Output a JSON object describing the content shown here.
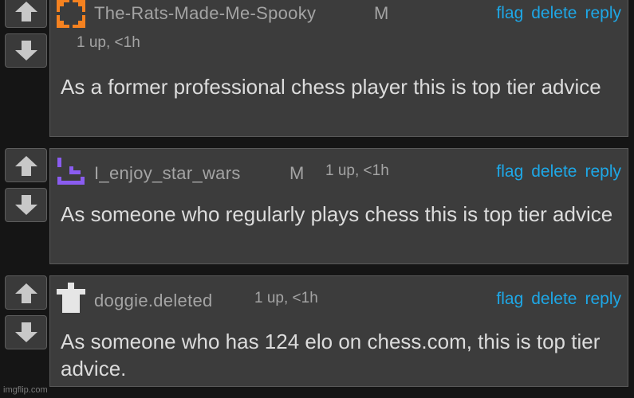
{
  "comments": [
    {
      "username": "The-Rats-Made-Me-Spooky",
      "mod_badge": "M",
      "meta": "1 up, <1h",
      "actions": {
        "flag": "flag",
        "delete": "delete",
        "reply": "reply"
      },
      "text": "As a former professional chess player this is top tier advice",
      "avatar_icon": "orange-corner-frame-icon",
      "avatar_color": "#f58220"
    },
    {
      "username": "I_enjoy_star_wars",
      "mod_badge": "M",
      "meta": "1 up, <1h",
      "actions": {
        "flag": "flag",
        "delete": "delete",
        "reply": "reply"
      },
      "text": "As someone who regularly plays chess this is top tier advice",
      "avatar_icon": "purple-smiley-icon",
      "avatar_color": "#8a5cf0"
    },
    {
      "username": "doggie.deleted",
      "mod_badge": "",
      "meta": "1 up, <1h",
      "actions": {
        "flag": "flag",
        "delete": "delete",
        "reply": "reply"
      },
      "text": "As someone who has 124 elo on chess.com, this is top tier advice.",
      "avatar_icon": "white-grave-cross-icon",
      "avatar_color": "#e6e6e6"
    }
  ],
  "colors": {
    "link": "#1ea7e6",
    "meta_text": "#a4a4a4",
    "body_text": "#dcdcdc"
  },
  "watermark": "imgflip.com"
}
